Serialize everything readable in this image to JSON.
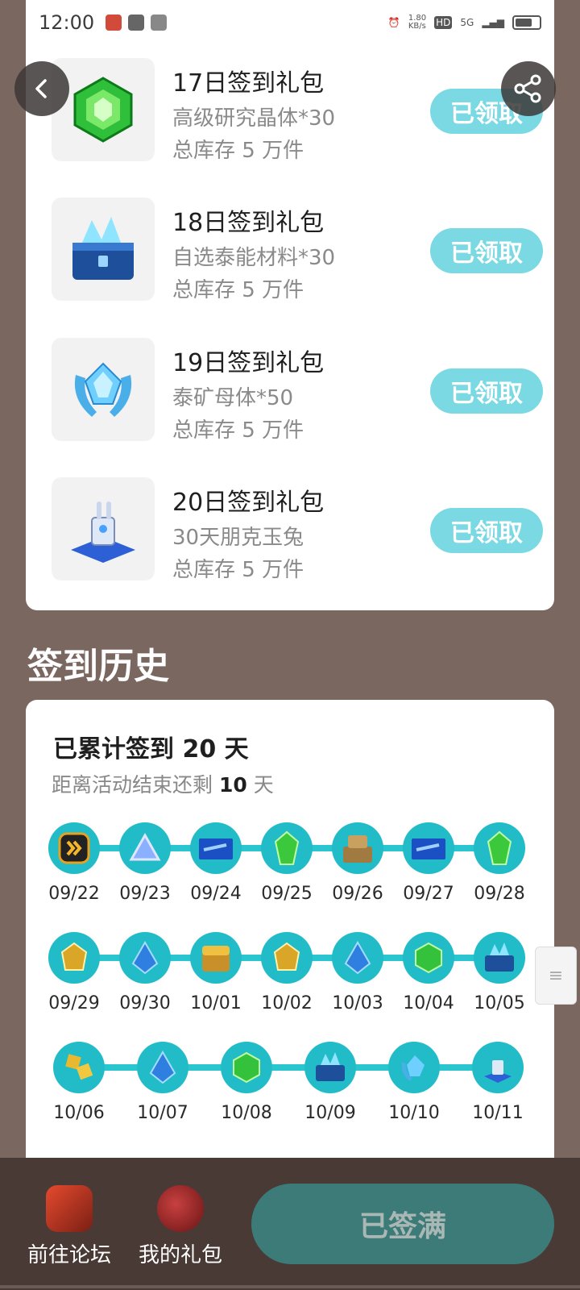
{
  "status_bar": {
    "time": "12:00",
    "net_speed": "1.80\nKB/s",
    "hd": "HD",
    "signal": "5G"
  },
  "gifts": [
    {
      "title": "17日签到礼包",
      "desc": "高级研究晶体*30",
      "stock": "总库存 5 万件",
      "button": "已领取",
      "icon": "green-crystal-icon"
    },
    {
      "title": "18日签到礼包",
      "desc": "自选泰能材料*30",
      "stock": "总库存 5 万件",
      "button": "已领取",
      "icon": "crystal-chest-icon"
    },
    {
      "title": "19日签到礼包",
      "desc": "泰矿母体*50",
      "stock": "总库存 5 万件",
      "button": "已领取",
      "icon": "blue-ore-icon"
    },
    {
      "title": "20日签到礼包",
      "desc": "30天朋克玉兔",
      "stock": "总库存 5 万件",
      "button": "已领取",
      "icon": "mecha-rabbit-icon"
    }
  ],
  "history": {
    "section_title": "签到历史",
    "total_prefix": "已累计签到 ",
    "total_days": "20",
    "total_suffix": " 天",
    "remain_prefix": "距离活动结束还剩 ",
    "remain_days": "10",
    "remain_suffix": " 天",
    "rows": [
      [
        "09/22",
        "09/23",
        "09/24",
        "09/25",
        "09/26",
        "09/27",
        "09/28"
      ],
      [
        "09/29",
        "09/30",
        "10/01",
        "10/02",
        "10/03",
        "10/04",
        "10/05"
      ],
      [
        "10/06",
        "10/07",
        "10/08",
        "10/09",
        "10/10",
        "10/11"
      ]
    ]
  },
  "bottom": {
    "forum_label": "前往论坛",
    "gifts_label": "我的礼包",
    "signed_full": "已签满"
  },
  "colors": {
    "accent": "#21bcc8",
    "claimed": "#7ad9e3",
    "background": "#7a6860",
    "bottom_bar": "#4a3a36"
  }
}
